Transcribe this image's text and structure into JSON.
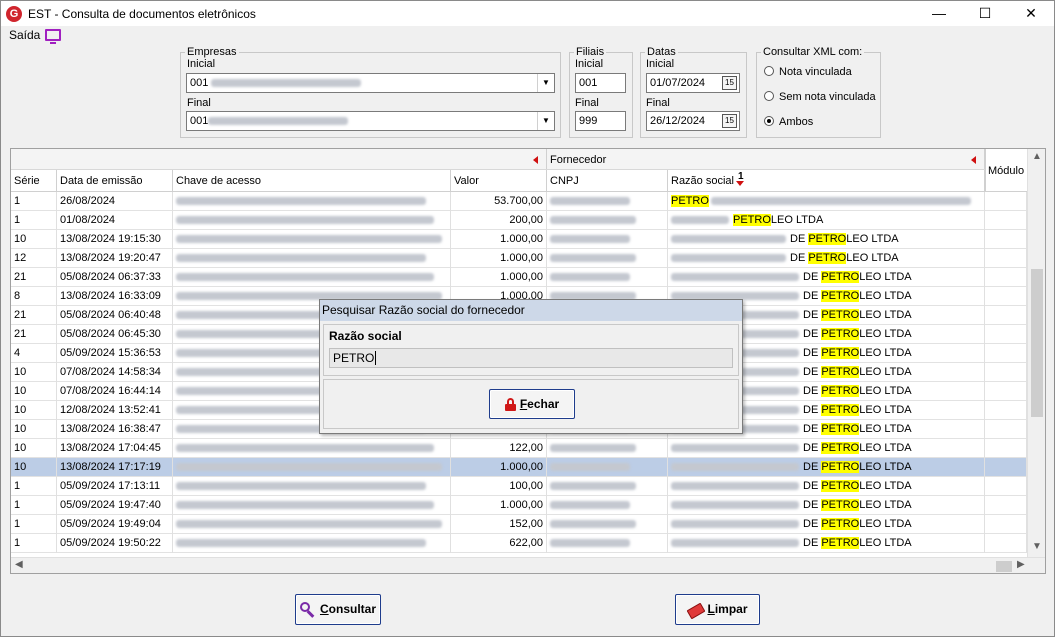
{
  "window": {
    "title": "EST - Consulta de documentos eletrônicos",
    "minimize": "—",
    "maximize": "☐",
    "close": "✕"
  },
  "menu": {
    "saida": "Saída"
  },
  "empresas": {
    "legend": "Empresas",
    "inicial_label": "Inicial",
    "inicial_value": "001",
    "final_label": "Final",
    "final_value": "001"
  },
  "filiais": {
    "legend": "Filiais",
    "inicial_label": "Inicial",
    "inicial_value": "001",
    "final_label": "Final",
    "final_value": "999"
  },
  "datas": {
    "legend": "Datas",
    "inicial_label": "Inicial",
    "inicial_value": "01/07/2024",
    "final_label": "Final",
    "final_value": "26/12/2024",
    "calendar_glyph": "15"
  },
  "consultar_xml": {
    "legend": "Consultar XML com:",
    "options": [
      "Nota vinculada",
      "Sem nota vinculada",
      "Ambos"
    ],
    "selected": "Ambos"
  },
  "grid": {
    "group_header": "Fornecedor",
    "columns": [
      "Série",
      "Data de emissão",
      "Chave de acesso",
      "Valor",
      "CNPJ",
      "Razão social",
      "Módulo"
    ],
    "sort_index": "1",
    "rows": [
      {
        "serie": "1",
        "data": "26/08/2024",
        "valor": "53.700,00",
        "pre": "",
        "hl": "PETRO",
        "post": ""
      },
      {
        "serie": "1",
        "data": "01/08/2024",
        "valor": "200,00",
        "pre": "",
        "hl": "PETRO",
        "post": "LEO LTDA"
      },
      {
        "serie": "10",
        "data": "13/08/2024 19:15:30",
        "valor": "1.000,00",
        "pre": "DE ",
        "hl": "PETRO",
        "post": "LEO LTDA"
      },
      {
        "serie": "12",
        "data": "13/08/2024 19:20:47",
        "valor": "1.000,00",
        "pre": "DE ",
        "hl": "PETRO",
        "post": "LEO LTDA"
      },
      {
        "serie": "21",
        "data": "05/08/2024 06:37:33",
        "valor": "1.000,00",
        "pre": "DE ",
        "hl": "PETRO",
        "post": "LEO LTDA"
      },
      {
        "serie": "8",
        "data": "13/08/2024 16:33:09",
        "valor": "1.000,00",
        "pre": "DE ",
        "hl": "PETRO",
        "post": "LEO LTDA"
      },
      {
        "serie": "21",
        "data": "05/08/2024 06:40:48",
        "valor": "",
        "pre": "DE ",
        "hl": "PETRO",
        "post": "LEO LTDA"
      },
      {
        "serie": "21",
        "data": "05/08/2024 06:45:30",
        "valor": "",
        "pre": "DE ",
        "hl": "PETRO",
        "post": "LEO LTDA"
      },
      {
        "serie": "4",
        "data": "05/09/2024 15:36:53",
        "valor": "",
        "pre": "DE ",
        "hl": "PETRO",
        "post": "LEO LTDA"
      },
      {
        "serie": "10",
        "data": "07/08/2024 14:58:34",
        "valor": "",
        "pre": "DE ",
        "hl": "PETRO",
        "post": "LEO LTDA"
      },
      {
        "serie": "10",
        "data": "07/08/2024 16:44:14",
        "valor": "",
        "pre": "DE ",
        "hl": "PETRO",
        "post": "LEO LTDA"
      },
      {
        "serie": "10",
        "data": "12/08/2024 13:52:41",
        "valor": "",
        "pre": "DE ",
        "hl": "PETRO",
        "post": "LEO LTDA"
      },
      {
        "serie": "10",
        "data": "13/08/2024 16:38:47",
        "valor": "",
        "pre": "DE ",
        "hl": "PETRO",
        "post": "LEO LTDA"
      },
      {
        "serie": "10",
        "data": "13/08/2024 17:04:45",
        "valor": "122,00",
        "pre": "DE ",
        "hl": "PETRO",
        "post": "LEO LTDA"
      },
      {
        "serie": "10",
        "data": "13/08/2024 17:17:19",
        "valor": "1.000,00",
        "pre": "DE ",
        "hl": "PETRO",
        "post": "LEO LTDA",
        "selected": true
      },
      {
        "serie": "1",
        "data": "05/09/2024 17:13:11",
        "valor": "100,00",
        "pre": "DE ",
        "hl": "PETRO",
        "post": "LEO LTDA"
      },
      {
        "serie": "1",
        "data": "05/09/2024 19:47:40",
        "valor": "1.000,00",
        "pre": "DE ",
        "hl": "PETRO",
        "post": "LEO LTDA"
      },
      {
        "serie": "1",
        "data": "05/09/2024 19:49:04",
        "valor": "152,00",
        "pre": "DE ",
        "hl": "PETRO",
        "post": "LEO LTDA"
      },
      {
        "serie": "1",
        "data": "05/09/2024 19:50:22",
        "valor": "622,00",
        "pre": "DE ",
        "hl": "PETRO",
        "post": "LEO LTDA"
      }
    ]
  },
  "dialog": {
    "title": "Pesquisar Razão social do fornecedor",
    "label": "Razão social",
    "value": "PETRO",
    "close_button_prefix": "",
    "close_button_accel": "F",
    "close_button_rest": "echar"
  },
  "buttons": {
    "consultar_accel": "C",
    "consultar_rest": "onsultar",
    "limpar_accel": "L",
    "limpar_rest": "impar"
  }
}
